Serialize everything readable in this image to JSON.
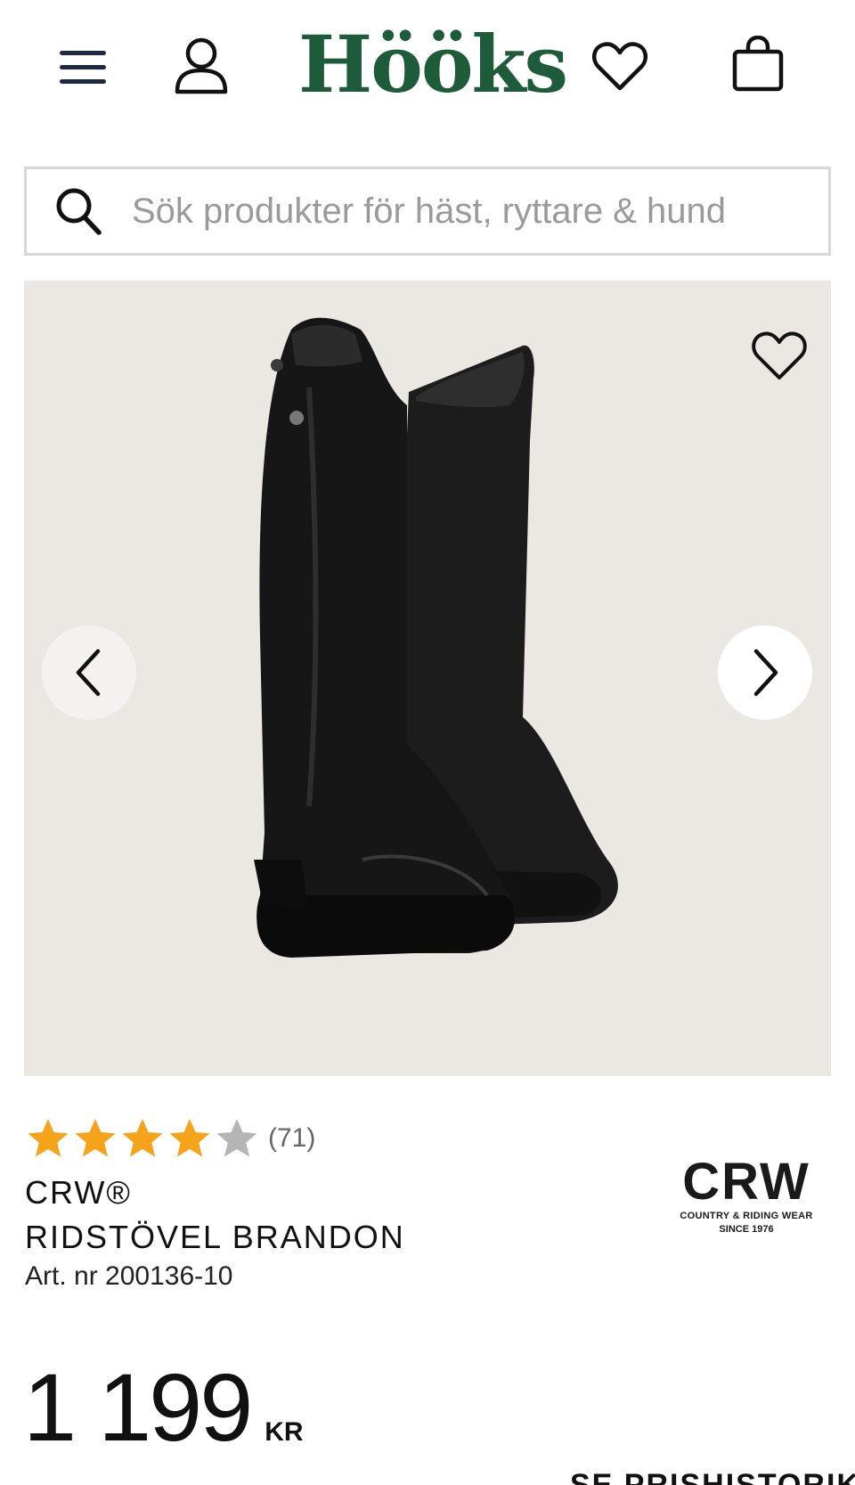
{
  "header": {
    "logo_text": "Hööks",
    "logo_color": "#1e5b3a",
    "icons": [
      "menu-icon",
      "user-icon",
      "heart-icon",
      "shopping-bag-icon"
    ]
  },
  "search": {
    "placeholder": "Sök produkter för häst, ryttare & hund",
    "value": ""
  },
  "gallery": {
    "image_alt": "CRW® Ridstövel Brandon",
    "icons": [
      "heart-icon",
      "chevron-left-icon",
      "chevron-right-icon"
    ]
  },
  "product": {
    "rating": 4,
    "rating_max": 5,
    "review_count": "(71)",
    "brand": "CRW®",
    "name": "RIDSTÖVEL BRANDON",
    "article_number": "Art. nr 200136-10",
    "price": "1 199",
    "currency": "KR",
    "price_history_label": "SE PRISHISTORIK",
    "star_color_filled": "#f5a31a",
    "star_color_empty": "#b5b5b5"
  },
  "brand_logo": {
    "main": "CRW",
    "sub": "COUNTRY & RIDING WEAR",
    "since": "SINCE 1976"
  }
}
